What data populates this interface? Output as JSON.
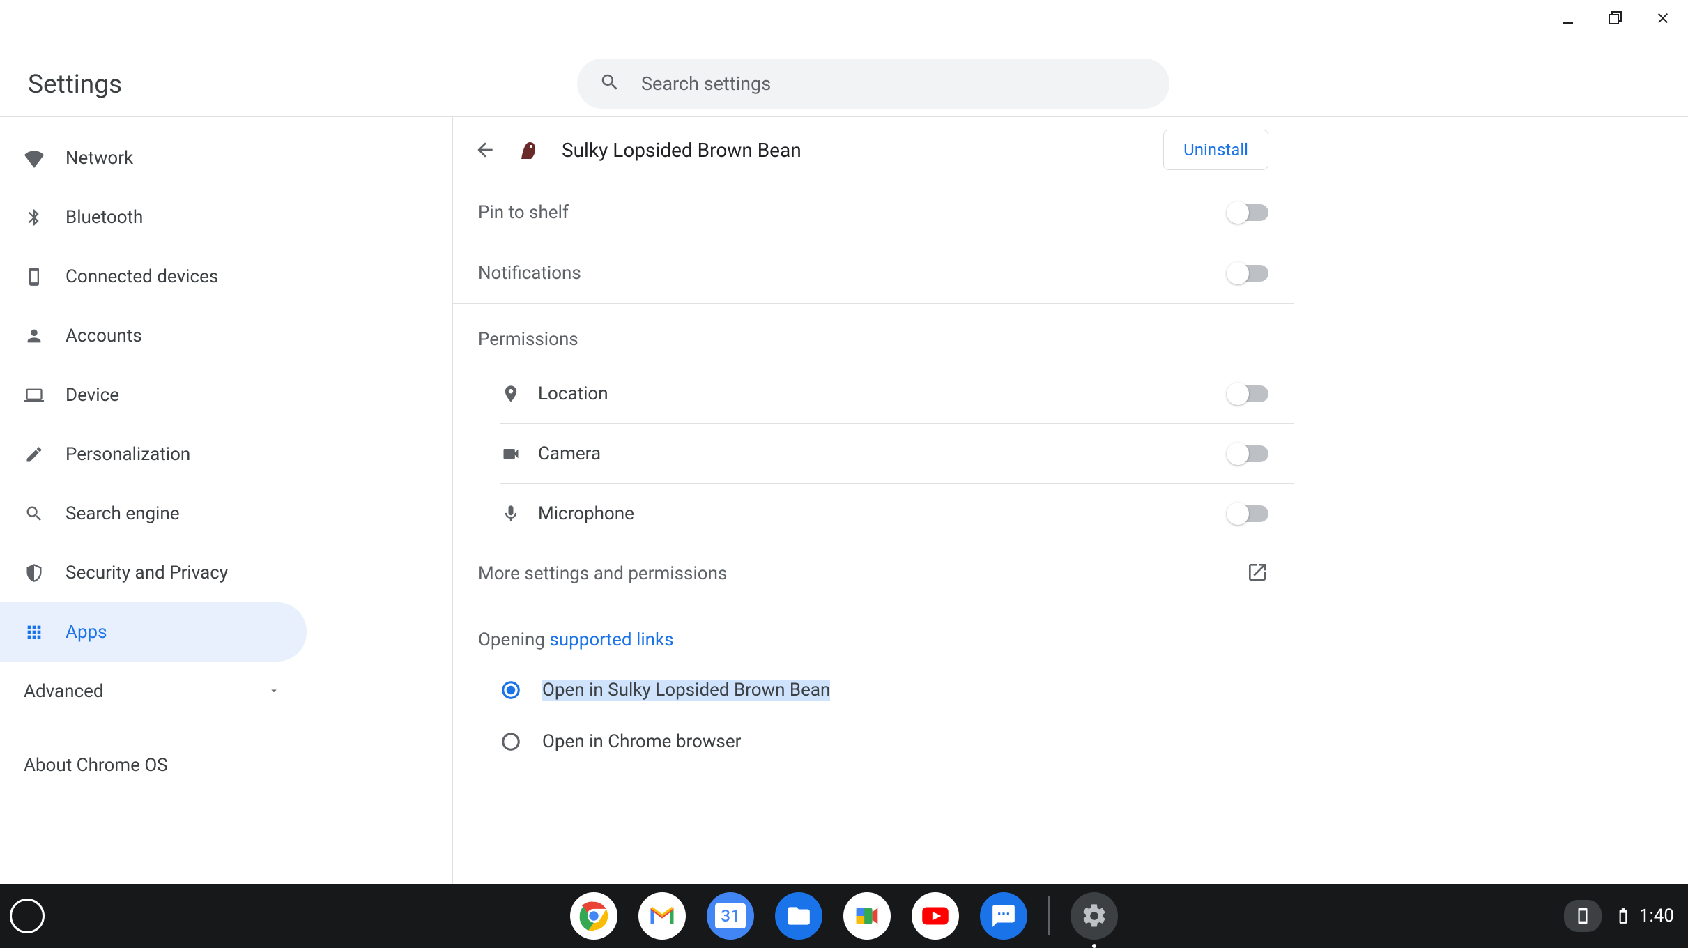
{
  "header": {
    "title": "Settings",
    "search_placeholder": "Search settings"
  },
  "sidebar": {
    "items": [
      {
        "label": "Network"
      },
      {
        "label": "Bluetooth"
      },
      {
        "label": "Connected devices"
      },
      {
        "label": "Accounts"
      },
      {
        "label": "Device"
      },
      {
        "label": "Personalization"
      },
      {
        "label": "Search engine"
      },
      {
        "label": "Security and Privacy"
      },
      {
        "label": "Apps"
      }
    ],
    "advanced": "Advanced",
    "about": "About Chrome OS"
  },
  "app": {
    "name": "Sulky Lopsided Brown Bean",
    "uninstall": "Uninstall"
  },
  "settings": {
    "pin_to_shelf": "Pin to shelf",
    "notifications": "Notifications",
    "permissions_header": "Permissions",
    "location": "Location",
    "camera": "Camera",
    "microphone": "Microphone",
    "more": "More settings and permissions",
    "opening_prefix": "Opening ",
    "supported_links": "supported links",
    "open_in_app": "Open in Sulky Lopsided Brown Bean",
    "open_in_chrome": "Open in Chrome browser"
  },
  "shelf": {
    "clock": "1:40",
    "calendar_day": "31"
  }
}
